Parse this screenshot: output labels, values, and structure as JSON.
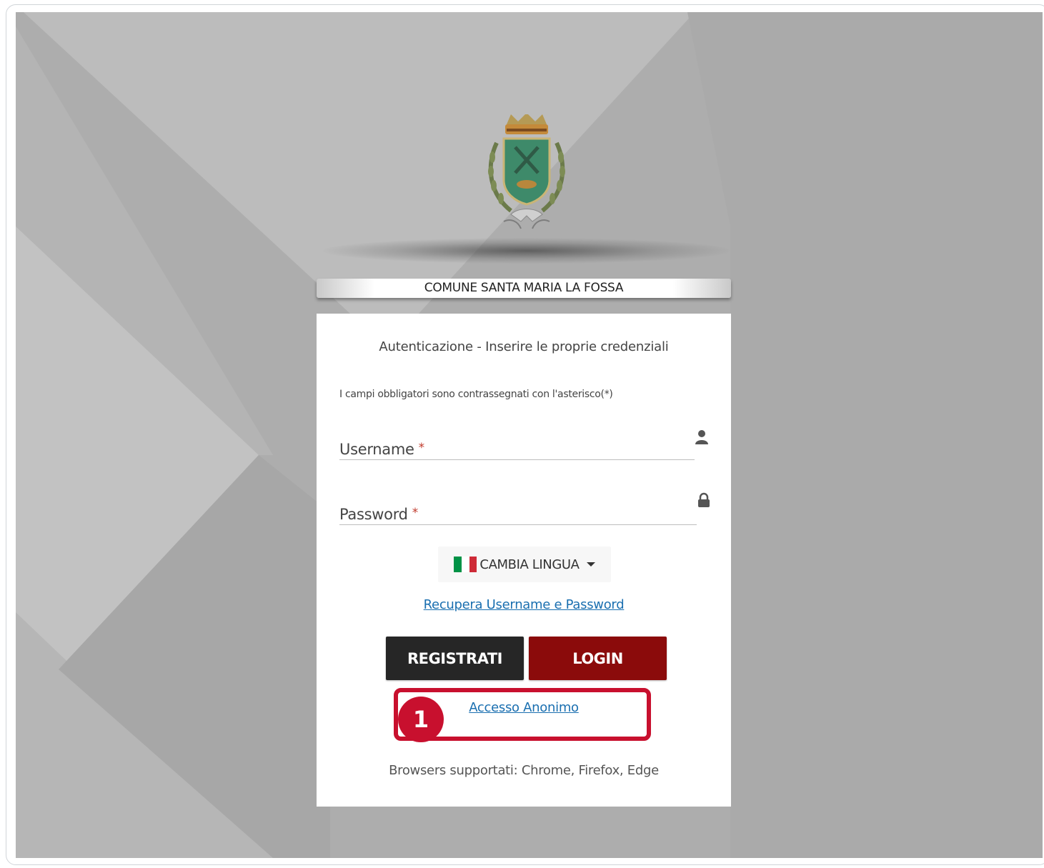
{
  "header": {
    "municipality_name": "COMUNE SANTA MARIA LA FOSSA"
  },
  "form": {
    "heading": "Autenticazione - Inserire le proprie credenziali",
    "required_note": "I campi obbligatori sono contrassegnati con l'asterisco(*)",
    "username_label": "Username",
    "password_label": "Password",
    "required_marker": "*",
    "language_button": "CAMBIA LINGUA",
    "recover_link": "Recupera Username e Password",
    "register_button": "REGISTRATI",
    "login_button": "LOGIN",
    "anonymous_link": "Accesso Anonimo",
    "annotation_number": "1",
    "supported_browsers": "Browsers supportati: Chrome, Firefox, Edge"
  },
  "icons": {
    "username": "user-icon",
    "password": "lock-icon",
    "language_flag": "italy-flag-icon",
    "dropdown": "caret-down-icon"
  },
  "colors": {
    "login_button": "#8b0b0b",
    "register_button": "#262626",
    "link": "#1a6fb0",
    "annotation": "#c8102e",
    "background": "#acacac"
  }
}
